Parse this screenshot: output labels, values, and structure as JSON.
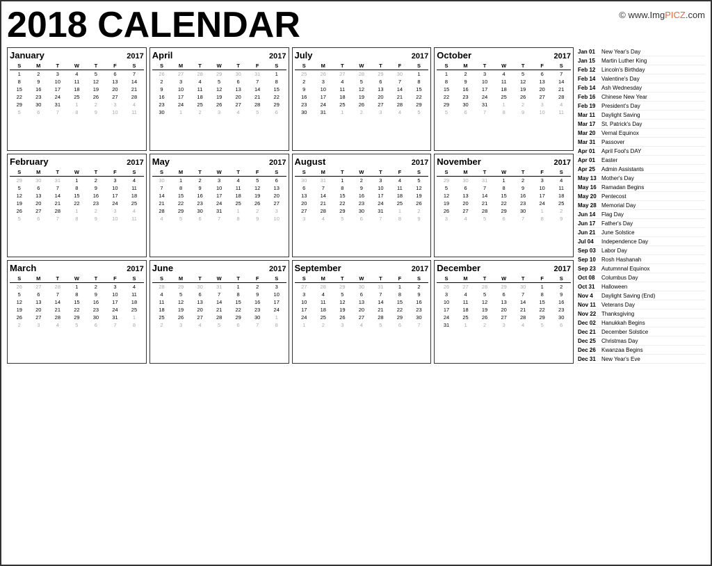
{
  "title": "2018 CALENDAR",
  "watermark": "© www.Img",
  "watermark2": "PICZ",
  "watermark3": ".com",
  "months": [
    {
      "name": "January",
      "year": "2017",
      "days": [
        "S",
        "M",
        "T",
        "W",
        "T",
        "F",
        "S"
      ],
      "weeks": [
        [
          "",
          "",
          "",
          "",
          "",
          "",
          ""
        ],
        [
          "1",
          "2",
          "3",
          "4",
          "5",
          "6",
          "7"
        ],
        [
          "8",
          "9",
          "10",
          "11",
          "12",
          "13",
          "14"
        ],
        [
          "15",
          "16",
          "17",
          "18",
          "19",
          "20",
          "21"
        ],
        [
          "22",
          "23",
          "24",
          "25",
          "26",
          "27",
          "28"
        ],
        [
          "29",
          "30",
          "31",
          "1",
          "2",
          "3",
          "4"
        ],
        [
          "5",
          "6",
          "7",
          "8",
          "9",
          "10",
          "11"
        ]
      ],
      "other": [
        [],
        [],
        [],
        [],
        [],
        [
          3,
          4,
          5,
          6
        ],
        [
          0,
          1,
          2,
          3,
          4,
          5,
          6
        ]
      ]
    },
    {
      "name": "April",
      "year": "2017",
      "days": [
        "S",
        "M",
        "T",
        "W",
        "T",
        "F",
        "S"
      ],
      "weeks": [
        [
          "26",
          "27",
          "28",
          "29",
          "30",
          "31",
          "1"
        ],
        [
          "2",
          "3",
          "4",
          "5",
          "6",
          "7",
          "8"
        ],
        [
          "9",
          "10",
          "11",
          "12",
          "13",
          "14",
          "15"
        ],
        [
          "16",
          "17",
          "18",
          "19",
          "20",
          "21",
          "22"
        ],
        [
          "23",
          "24",
          "25",
          "26",
          "27",
          "28",
          "29"
        ],
        [
          "30",
          "1",
          "2",
          "3",
          "4",
          "5",
          "6"
        ]
      ],
      "other": [
        [
          0,
          1,
          2,
          3,
          4,
          5
        ],
        [],
        [],
        [],
        [],
        [
          1,
          2,
          3,
          4,
          5,
          6
        ]
      ]
    },
    {
      "name": "July",
      "year": "2017",
      "days": [
        "S",
        "M",
        "T",
        "W",
        "T",
        "F",
        "S"
      ],
      "weeks": [
        [
          "25",
          "26",
          "27",
          "28",
          "29",
          "30",
          "1"
        ],
        [
          "2",
          "3",
          "4",
          "5",
          "6",
          "7",
          "8"
        ],
        [
          "9",
          "10",
          "11",
          "12",
          "13",
          "14",
          "15"
        ],
        [
          "16",
          "17",
          "18",
          "19",
          "20",
          "21",
          "22"
        ],
        [
          "23",
          "24",
          "25",
          "26",
          "27",
          "28",
          "29"
        ],
        [
          "30",
          "31",
          "1",
          "2",
          "3",
          "4",
          "5"
        ]
      ],
      "other": [
        [
          0,
          1,
          2,
          3,
          4,
          5
        ],
        [],
        [],
        [],
        [],
        [
          2,
          3,
          4,
          5,
          6
        ]
      ]
    },
    {
      "name": "October",
      "year": "2017",
      "days": [
        "S",
        "M",
        "T",
        "W",
        "T",
        "F",
        "S"
      ],
      "weeks": [
        [
          "1",
          "2",
          "3",
          "4",
          "5",
          "6",
          "7"
        ],
        [
          "8",
          "9",
          "10",
          "11",
          "12",
          "13",
          "14"
        ],
        [
          "15",
          "16",
          "17",
          "18",
          "19",
          "20",
          "21"
        ],
        [
          "22",
          "23",
          "24",
          "25",
          "26",
          "27",
          "28"
        ],
        [
          "29",
          "30",
          "31",
          "1",
          "2",
          "3",
          "4"
        ],
        [
          "5",
          "6",
          "7",
          "8",
          "9",
          "10",
          "11"
        ]
      ],
      "other": [
        [],
        [],
        [],
        [],
        [
          3,
          4,
          5,
          6
        ],
        [
          0,
          1,
          2,
          3,
          4,
          5,
          6
        ]
      ]
    },
    {
      "name": "February",
      "year": "2017",
      "days": [
        "S",
        "M",
        "T",
        "W",
        "T",
        "F",
        "S"
      ],
      "weeks": [
        [
          "29",
          "30",
          "31",
          "1",
          "2",
          "3",
          "4"
        ],
        [
          "5",
          "6",
          "7",
          "8",
          "9",
          "10",
          "11"
        ],
        [
          "12",
          "13",
          "14",
          "15",
          "16",
          "17",
          "18"
        ],
        [
          "19",
          "20",
          "21",
          "22",
          "23",
          "24",
          "25"
        ],
        [
          "26",
          "27",
          "28",
          "1",
          "2",
          "3",
          "4"
        ],
        [
          "5",
          "6",
          "7",
          "8",
          "9",
          "10",
          "11"
        ]
      ],
      "other": [
        [
          0,
          1,
          2
        ],
        [],
        [],
        [],
        [
          3,
          4,
          5,
          6
        ],
        [
          0,
          1,
          2,
          3,
          4,
          5,
          6
        ]
      ]
    },
    {
      "name": "May",
      "year": "2017",
      "days": [
        "S",
        "M",
        "T",
        "W",
        "T",
        "F",
        "S"
      ],
      "weeks": [
        [
          "30",
          "1",
          "2",
          "3",
          "4",
          "5",
          "6"
        ],
        [
          "7",
          "8",
          "9",
          "10",
          "11",
          "12",
          "13"
        ],
        [
          "14",
          "15",
          "16",
          "17",
          "18",
          "19",
          "20"
        ],
        [
          "21",
          "22",
          "23",
          "24",
          "25",
          "26",
          "27"
        ],
        [
          "28",
          "29",
          "30",
          "31",
          "1",
          "2",
          "3"
        ],
        [
          "4",
          "5",
          "6",
          "7",
          "8",
          "9",
          "10"
        ]
      ],
      "other": [
        [
          0
        ],
        [],
        [],
        [],
        [
          4,
          5,
          6
        ],
        [
          0,
          1,
          2,
          3,
          4,
          5,
          6
        ]
      ]
    },
    {
      "name": "August",
      "year": "2017",
      "days": [
        "S",
        "M",
        "T",
        "W",
        "T",
        "F",
        "S"
      ],
      "weeks": [
        [
          "30",
          "31",
          "1",
          "2",
          "3",
          "4",
          "5"
        ],
        [
          "6",
          "7",
          "8",
          "9",
          "10",
          "11",
          "12"
        ],
        [
          "13",
          "14",
          "15",
          "16",
          "17",
          "18",
          "19"
        ],
        [
          "20",
          "21",
          "22",
          "23",
          "24",
          "25",
          "26"
        ],
        [
          "27",
          "28",
          "29",
          "30",
          "31",
          "1",
          "2"
        ],
        [
          "3",
          "4",
          "5",
          "6",
          "7",
          "8",
          "9"
        ]
      ],
      "other": [
        [
          0,
          1
        ],
        [],
        [],
        [],
        [
          5,
          6
        ],
        [
          0,
          1,
          2,
          3,
          4,
          5,
          6
        ]
      ]
    },
    {
      "name": "November",
      "year": "2017",
      "days": [
        "S",
        "M",
        "T",
        "W",
        "T",
        "F",
        "S"
      ],
      "weeks": [
        [
          "29",
          "30",
          "31",
          "1",
          "2",
          "3",
          "4"
        ],
        [
          "5",
          "6",
          "7",
          "8",
          "9",
          "10",
          "11"
        ],
        [
          "12",
          "13",
          "14",
          "15",
          "16",
          "17",
          "18"
        ],
        [
          "19",
          "20",
          "21",
          "22",
          "23",
          "24",
          "25"
        ],
        [
          "26",
          "27",
          "28",
          "29",
          "30",
          "1",
          "2"
        ],
        [
          "3",
          "4",
          "5",
          "6",
          "7",
          "8",
          "9"
        ]
      ],
      "other": [
        [
          0,
          1,
          2
        ],
        [],
        [],
        [],
        [
          5,
          6
        ],
        [
          0,
          1,
          2,
          3,
          4,
          5,
          6
        ]
      ]
    },
    {
      "name": "March",
      "year": "2017",
      "days": [
        "S",
        "M",
        "T",
        "W",
        "T",
        "F",
        "S"
      ],
      "weeks": [
        [
          "26",
          "27",
          "28",
          "1",
          "2",
          "3",
          "4"
        ],
        [
          "5",
          "6",
          "7",
          "8",
          "9",
          "10",
          "11"
        ],
        [
          "12",
          "13",
          "14",
          "15",
          "16",
          "17",
          "18"
        ],
        [
          "19",
          "20",
          "21",
          "22",
          "23",
          "24",
          "25"
        ],
        [
          "26",
          "27",
          "28",
          "29",
          "30",
          "31",
          "1"
        ],
        [
          "2",
          "3",
          "4",
          "5",
          "6",
          "7",
          "8"
        ]
      ],
      "other": [
        [
          0,
          1,
          2
        ],
        [],
        [],
        [],
        [
          6
        ],
        [
          0,
          1,
          2,
          3,
          4,
          5,
          6
        ]
      ]
    },
    {
      "name": "June",
      "year": "2017",
      "days": [
        "S",
        "M",
        "T",
        "W",
        "T",
        "F",
        "S"
      ],
      "weeks": [
        [
          "28",
          "29",
          "30",
          "31",
          "1",
          "2",
          "3"
        ],
        [
          "4",
          "5",
          "6",
          "7",
          "8",
          "9",
          "10"
        ],
        [
          "11",
          "12",
          "13",
          "14",
          "15",
          "16",
          "17"
        ],
        [
          "18",
          "19",
          "20",
          "21",
          "22",
          "23",
          "24"
        ],
        [
          "25",
          "26",
          "27",
          "28",
          "29",
          "30",
          "1"
        ],
        [
          "2",
          "3",
          "4",
          "5",
          "6",
          "7",
          "8"
        ]
      ],
      "other": [
        [
          0,
          1,
          2,
          3
        ],
        [],
        [],
        [],
        [
          6
        ],
        [
          0,
          1,
          2,
          3,
          4,
          5,
          6
        ]
      ]
    },
    {
      "name": "September",
      "year": "2017",
      "days": [
        "S",
        "M",
        "T",
        "W",
        "T",
        "F",
        "S"
      ],
      "weeks": [
        [
          "27",
          "28",
          "29",
          "30",
          "31",
          "1",
          "2"
        ],
        [
          "3",
          "4",
          "5",
          "6",
          "7",
          "8",
          "9"
        ],
        [
          "10",
          "11",
          "12",
          "13",
          "14",
          "15",
          "16"
        ],
        [
          "17",
          "18",
          "19",
          "20",
          "21",
          "22",
          "23"
        ],
        [
          "24",
          "25",
          "26",
          "27",
          "28",
          "29",
          "30"
        ],
        [
          "1",
          "2",
          "3",
          "4",
          "5",
          "6",
          "7"
        ]
      ],
      "other": [
        [
          0,
          1,
          2,
          3,
          4
        ],
        [],
        [],
        [],
        [],
        [
          0,
          1,
          2,
          3,
          4,
          5,
          6
        ]
      ]
    },
    {
      "name": "December",
      "year": "2017",
      "days": [
        "S",
        "M",
        "T",
        "W",
        "T",
        "F",
        "S"
      ],
      "weeks": [
        [
          "26",
          "27",
          "28",
          "29",
          "30",
          "1",
          "2"
        ],
        [
          "3",
          "4",
          "5",
          "6",
          "7",
          "8",
          "9"
        ],
        [
          "10",
          "11",
          "12",
          "13",
          "14",
          "15",
          "16"
        ],
        [
          "17",
          "18",
          "19",
          "20",
          "21",
          "22",
          "23"
        ],
        [
          "24",
          "25",
          "26",
          "27",
          "28",
          "29",
          "30"
        ],
        [
          "31",
          "1",
          "2",
          "3",
          "4",
          "5",
          "6"
        ]
      ],
      "other": [
        [
          0,
          1,
          2,
          3,
          4
        ],
        [],
        [],
        [],
        [],
        [
          1,
          2,
          3,
          4,
          5,
          6
        ]
      ]
    }
  ],
  "holidays": [
    {
      "date": "Jan 01",
      "name": "New Year's Day"
    },
    {
      "date": "Jan 15",
      "name": "Martin Luther King"
    },
    {
      "date": "Feb 12",
      "name": "Lincoln's Birthday"
    },
    {
      "date": "Feb 14",
      "name": "Valentine's Day"
    },
    {
      "date": "Feb 14",
      "name": "Ash Wednesday"
    },
    {
      "date": "Feb 16",
      "name": "Chinese New Year"
    },
    {
      "date": "Feb 19",
      "name": "President's Day"
    },
    {
      "date": "Mar 11",
      "name": "Daylight Saving"
    },
    {
      "date": "Mar 17",
      "name": "St. Patrick's Day"
    },
    {
      "date": "Mar 20",
      "name": "Vernal Equinox"
    },
    {
      "date": "Mar 31",
      "name": "Passover"
    },
    {
      "date": "Apr 01",
      "name": "April Fool's DAY"
    },
    {
      "date": "Apr 01",
      "name": "Easter"
    },
    {
      "date": "Apr 25",
      "name": "Admin Assistants"
    },
    {
      "date": "May 13",
      "name": "Mother's Day"
    },
    {
      "date": "May 16",
      "name": "Ramadan Begins"
    },
    {
      "date": "May 20",
      "name": "Pentecost"
    },
    {
      "date": "May 28",
      "name": "Memorial Day"
    },
    {
      "date": "Jun 14",
      "name": "Flag Day"
    },
    {
      "date": "Jun 17",
      "name": "Father's Day"
    },
    {
      "date": "Jun 21",
      "name": "June Solstice"
    },
    {
      "date": "Jul 04",
      "name": "Independence Day"
    },
    {
      "date": "Sep 03",
      "name": "Labor Day"
    },
    {
      "date": "Sep 10",
      "name": "Rosh Hashanah"
    },
    {
      "date": "Sep 23",
      "name": "Autumnnal Equinox"
    },
    {
      "date": "Oct 08",
      "name": "Columbus Day"
    },
    {
      "date": "Oct 31",
      "name": "Halloween"
    },
    {
      "date": "Nov 4",
      "name": "Daylight Saving (End)"
    },
    {
      "date": "Nov 11",
      "name": "Veterans Day"
    },
    {
      "date": "Nov 22",
      "name": "Thanksgiving"
    },
    {
      "date": "Dec 02",
      "name": "Hanukkah Begins"
    },
    {
      "date": "Dec 21",
      "name": "December Solstice"
    },
    {
      "date": "Dec 25",
      "name": "Christmas Day"
    },
    {
      "date": "Dec 26",
      "name": "Kwanzaa Begins"
    },
    {
      "date": "Dec 31",
      "name": "New Year's Eve"
    }
  ]
}
